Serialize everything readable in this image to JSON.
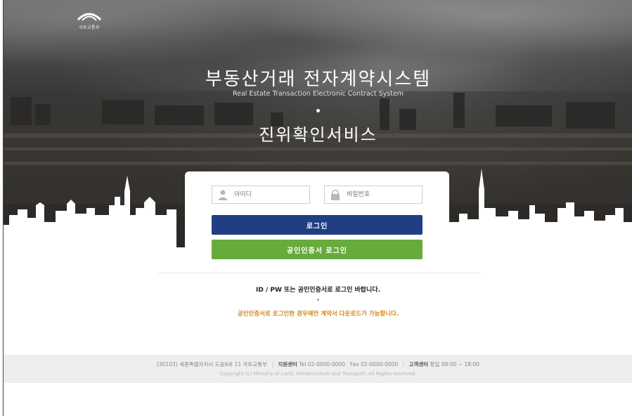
{
  "logo": {
    "text": "국토교통부",
    "icon": "ministry-logo-icon"
  },
  "hero": {
    "title": "부동산거래 전자계약시스템",
    "subtitle": "Real Estate Transaction Electronic Contract System",
    "service_title": "진위확인서비스"
  },
  "login": {
    "id_placeholder": "아이디",
    "pw_placeholder": "비밀번호",
    "login_button": "로그인",
    "cert_login_button": "공인인증서 로그인",
    "colors": {
      "login": "#213e84",
      "cert": "#67ab3c"
    }
  },
  "notices": {
    "primary": "ID / PW 또는 공인인증서로 로그인 바랍니다.",
    "secondary": "공인인증서로 로그인한 경우에만 계약서 다운로드가 가능합니다.",
    "secondary_color": "#d08a1a"
  },
  "footer": {
    "address": "(30103) 세종특별자치시 도움6로 11 국토교통부",
    "support_label": "지원센터",
    "support_tel": "Tel 02-0000-0000",
    "support_fax": "Fax 02-0000-0000",
    "customer_label": "고객센터",
    "customer_hours": "평일 09:00 ~ 18:00",
    "copyright": "Copyright (c) Ministry of Land, Infrastructure and Transport. All Rights reserved."
  }
}
